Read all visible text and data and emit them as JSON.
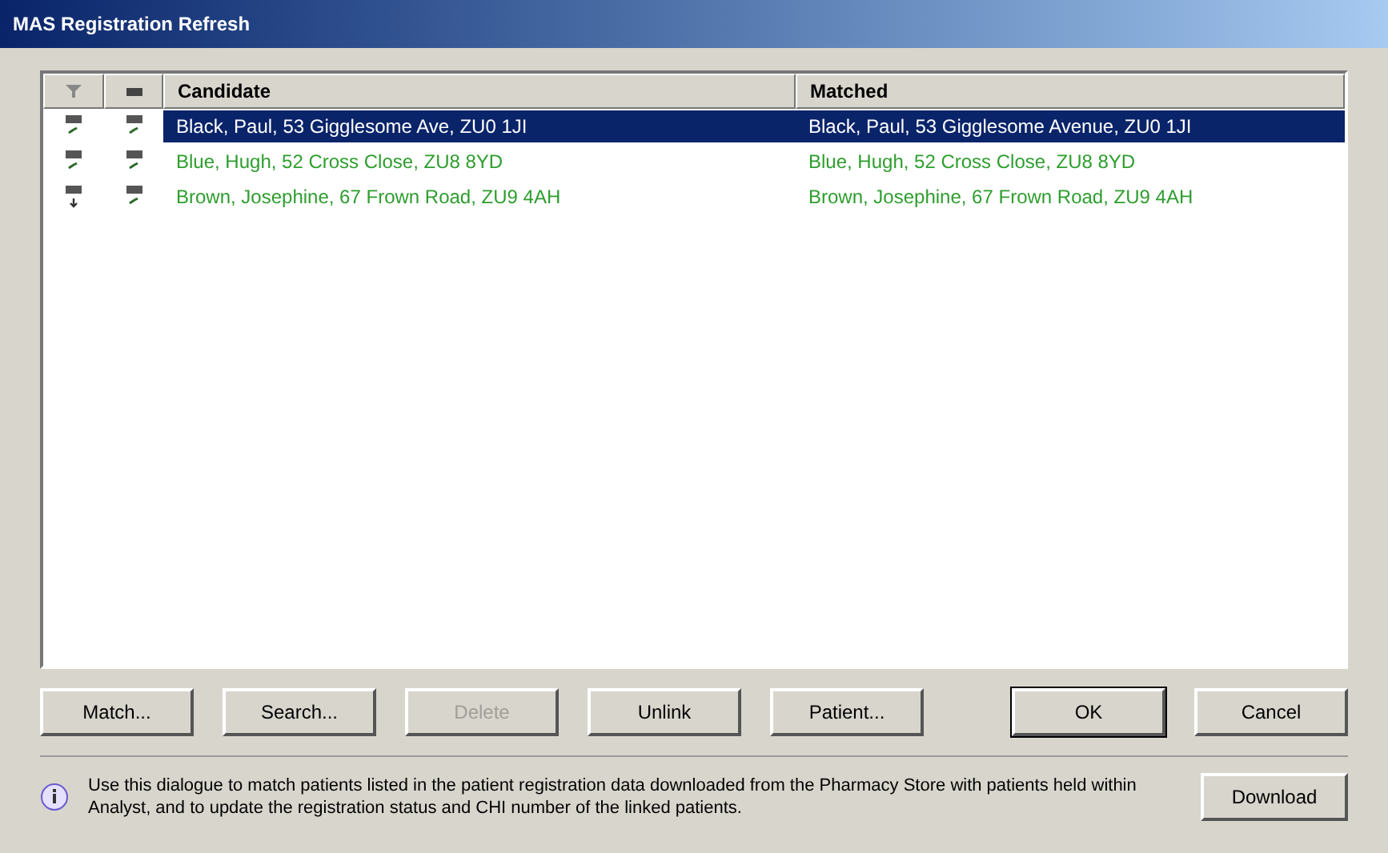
{
  "window": {
    "title": "MAS Registration Refresh"
  },
  "table": {
    "columns": [
      {
        "label": "Candidate"
      },
      {
        "label": "Matched"
      }
    ],
    "rows": [
      {
        "selected": true,
        "icons": [
          {
            "kind": "tick"
          },
          {
            "kind": "tick"
          }
        ],
        "candidate": "Black, Paul, 53 Gigglesome Ave, ZU0 1JI",
        "matched": "Black, Paul, 53 Gigglesome Avenue, ZU0 1JI"
      },
      {
        "selected": false,
        "icons": [
          {
            "kind": "tick"
          },
          {
            "kind": "tick"
          }
        ],
        "candidate": "Blue, Hugh, 52 Cross Close, ZU8 8YD",
        "matched": "Blue, Hugh, 52 Cross Close, ZU8 8YD"
      },
      {
        "selected": false,
        "icons": [
          {
            "kind": "arrow"
          },
          {
            "kind": "tick"
          }
        ],
        "candidate": "Brown, Josephine, 67 Frown Road, ZU9 4AH",
        "matched": "Brown, Josephine, 67 Frown Road, ZU9 4AH"
      }
    ]
  },
  "buttons": [
    {
      "label": "Match...",
      "disabled": false
    },
    {
      "label": "Search...",
      "disabled": false
    },
    {
      "label": "Delete",
      "disabled": true
    },
    {
      "label": "Unlink",
      "disabled": false
    },
    {
      "label": "Patient...",
      "disabled": false
    }
  ],
  "dialog_buttons": [
    {
      "label": "OK",
      "default": true
    },
    {
      "label": "Cancel",
      "default": false
    }
  ],
  "info": "Use this dialogue to match patients listed in the patient registration data downloaded from the Pharmacy Store with patients held within Analyst, and to update the registration status and CHI number of the linked patients.",
  "download_button": "Download"
}
